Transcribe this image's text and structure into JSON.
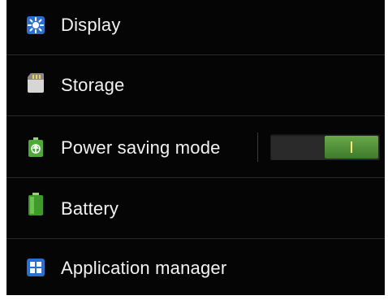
{
  "settings": {
    "items": [
      {
        "label": "Display",
        "icon": "display-brightness-icon"
      },
      {
        "label": "Storage",
        "icon": "sd-card-icon"
      },
      {
        "label": "Power saving mode",
        "icon": "power-saving-recycle-icon",
        "toggle": {
          "state": "on",
          "color": "#4f8f36"
        }
      },
      {
        "label": "Battery",
        "icon": "battery-icon"
      },
      {
        "label": "Application manager",
        "icon": "application-manager-grid-icon"
      }
    ]
  },
  "colors": {
    "background": "#050505",
    "text": "#f2f2f2",
    "divider": "#2a2a2a",
    "toggle_on": "#4f8f36",
    "toggle_indicator": "#f5e97a"
  }
}
